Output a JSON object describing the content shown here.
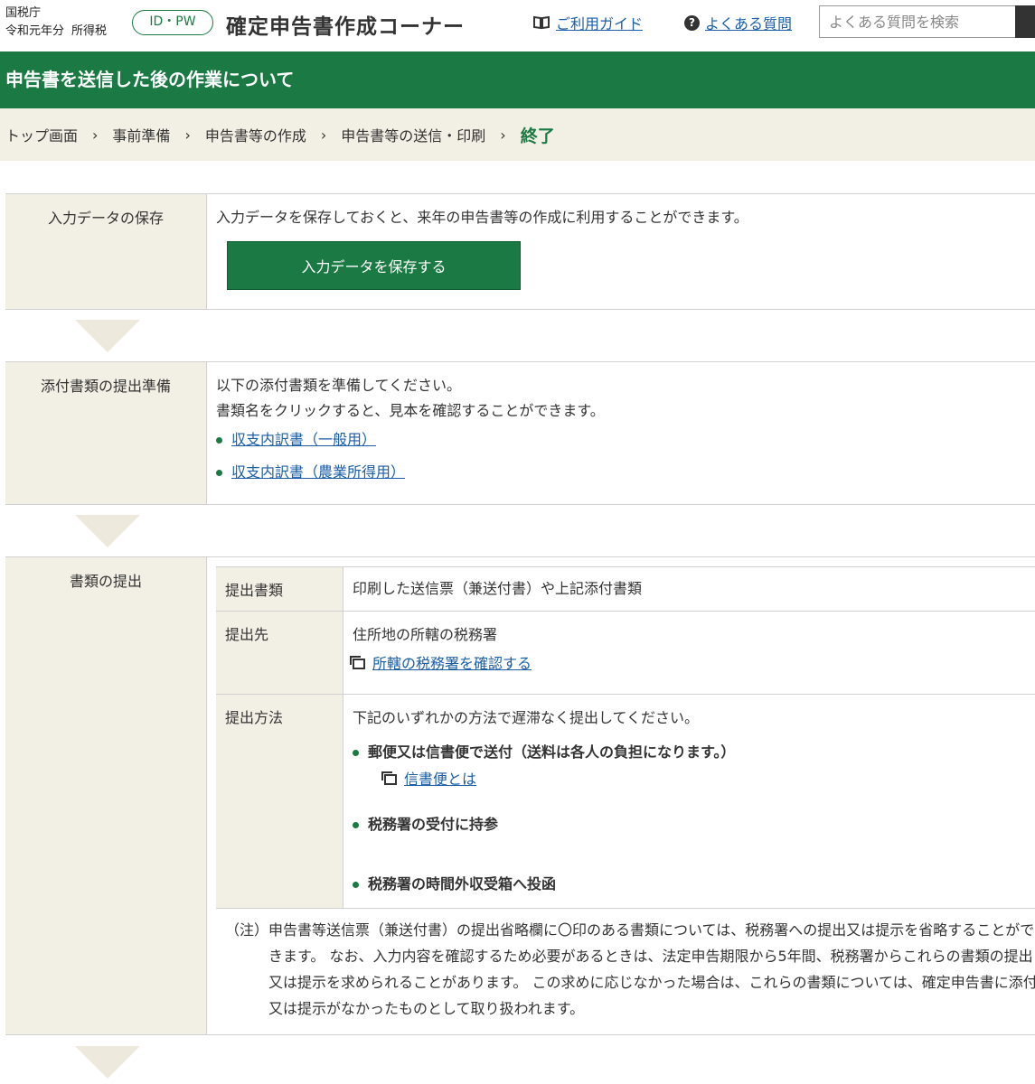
{
  "header": {
    "agency": "国税庁",
    "year": "令和元年分",
    "tax_type": "所得税",
    "idpw_label": "ID・PW",
    "site_title": "確定申告書作成コーナー",
    "guide_label": "ご利用ガイド",
    "faq_icon": "?",
    "faq_label": "よくある質問",
    "search_placeholder": "よくある質問を検索"
  },
  "page_title": "申告書を送信した後の作業について",
  "breadcrumb": {
    "items": [
      "トップ画面",
      "事前準備",
      "申告書等の作成",
      "申告書等の送信・印刷"
    ],
    "separator": "›",
    "current": "終了"
  },
  "save_section": {
    "label": "入力データの保存",
    "description": "入力データを保存しておくと、来年の申告書等の作成に利用することができます。",
    "button_label": "入力データを保存する"
  },
  "attach_section": {
    "label": "添付書類の提出準備",
    "line1": "以下の添付書類を準備してください。",
    "line2": "書類名をクリックすると、見本を確認することができます。",
    "links": [
      "収支内訳書（一般用）",
      "収支内訳書（農業所得用）"
    ]
  },
  "submit_section": {
    "label": "書類の提出",
    "rows": {
      "documents": {
        "header": "提出書類",
        "value": "印刷した送信票（兼送付書）や上記添付書類"
      },
      "destination": {
        "header": "提出先",
        "value": "住所地の所轄の税務署",
        "link": "所轄の税務署を確認する"
      },
      "method": {
        "header": "提出方法",
        "intro": "下記のいずれかの方法で遅滞なく提出してください。",
        "options": [
          "郵便又は信書便で送付（送料は各人の負担になります。）",
          "税務署の受付に持参",
          "税務署の時間外収受箱へ投函"
        ],
        "sub_link": "信書便とは"
      }
    },
    "note_mark": "（注）",
    "note_text": "申告書等送信票（兼送付書）の提出省略欄に〇印のある書類については、税務署への提出又は提示を省略することができます。 なお、入力内容を確認するため必要があるときは、法定申告期限から5年間、税務署からこれらの書類の提出又は提示を求められることがあります。 この求めに応じなかった場合は、これらの書類については、確定申告書に添付又は提示がなかったものとして取り扱われます。"
  },
  "colors": {
    "brand_green": "#1b7a44",
    "label_bg": "#f2efe4",
    "link": "#1a5ea8"
  }
}
